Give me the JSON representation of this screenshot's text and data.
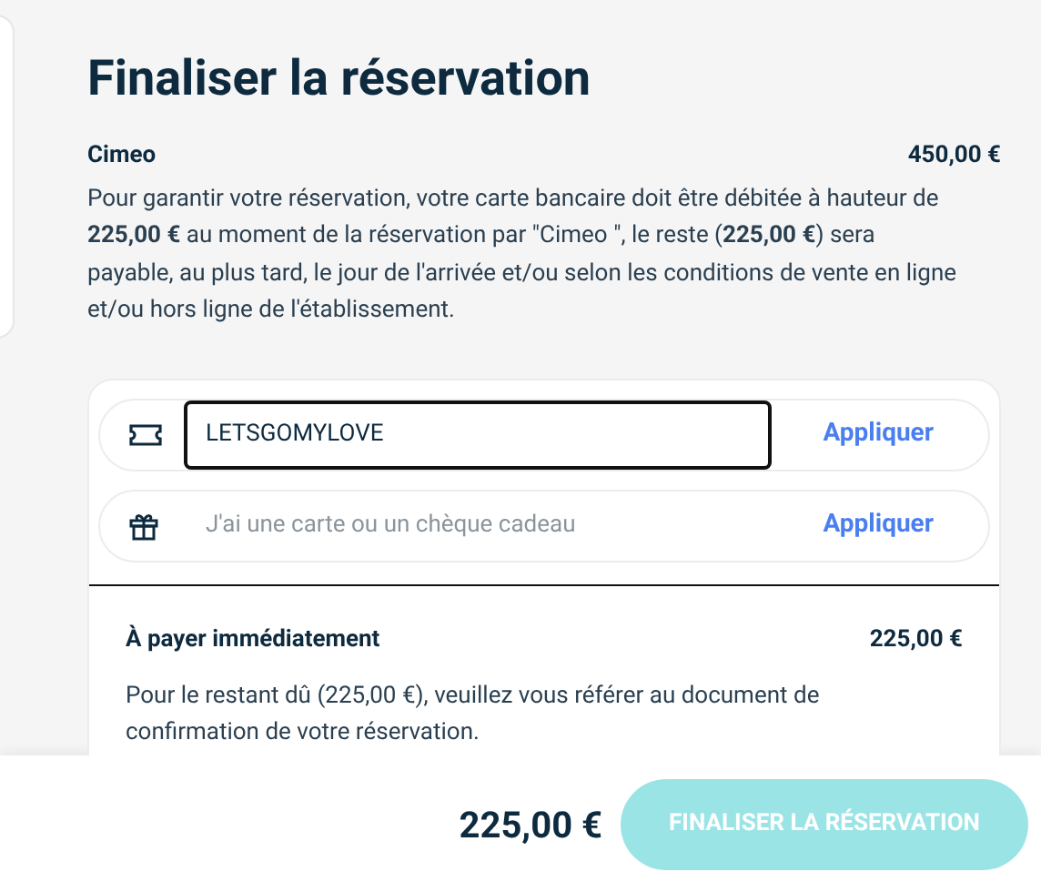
{
  "title": "Finaliser la réservation",
  "summary": {
    "name": "Cimeo",
    "price": "450,00 €",
    "text": "Pour garantir votre réservation, votre carte bancaire doit être débitée à hauteur de **225,00 €** au moment de la réservation par \"Cimeo \", le reste (**225,00 €**) sera payable, au plus tard, le jour de l'arrivée et/ou selon les conditions de vente en ligne et/ou hors ligne de l'établissement."
  },
  "codes": [
    {
      "kind": "voucher",
      "value": "LETSGOMYLOVE",
      "focused": true,
      "button": "Appliquer"
    },
    {
      "kind": "gift",
      "placeholder": "J'ai une carte ou un chèque cadeau",
      "focused": false,
      "button": "Appliquer"
    }
  ],
  "payment": {
    "label": "À payer immédiatement",
    "amount": "225,00 €",
    "note": "Pour le restant dû (225,00 €), veuillez vous référer au document de confirmation de votre réservation."
  },
  "footer": {
    "total": "225,00 €",
    "button": "FINALISER LA RÉSERVATION",
    "disabled": true
  }
}
